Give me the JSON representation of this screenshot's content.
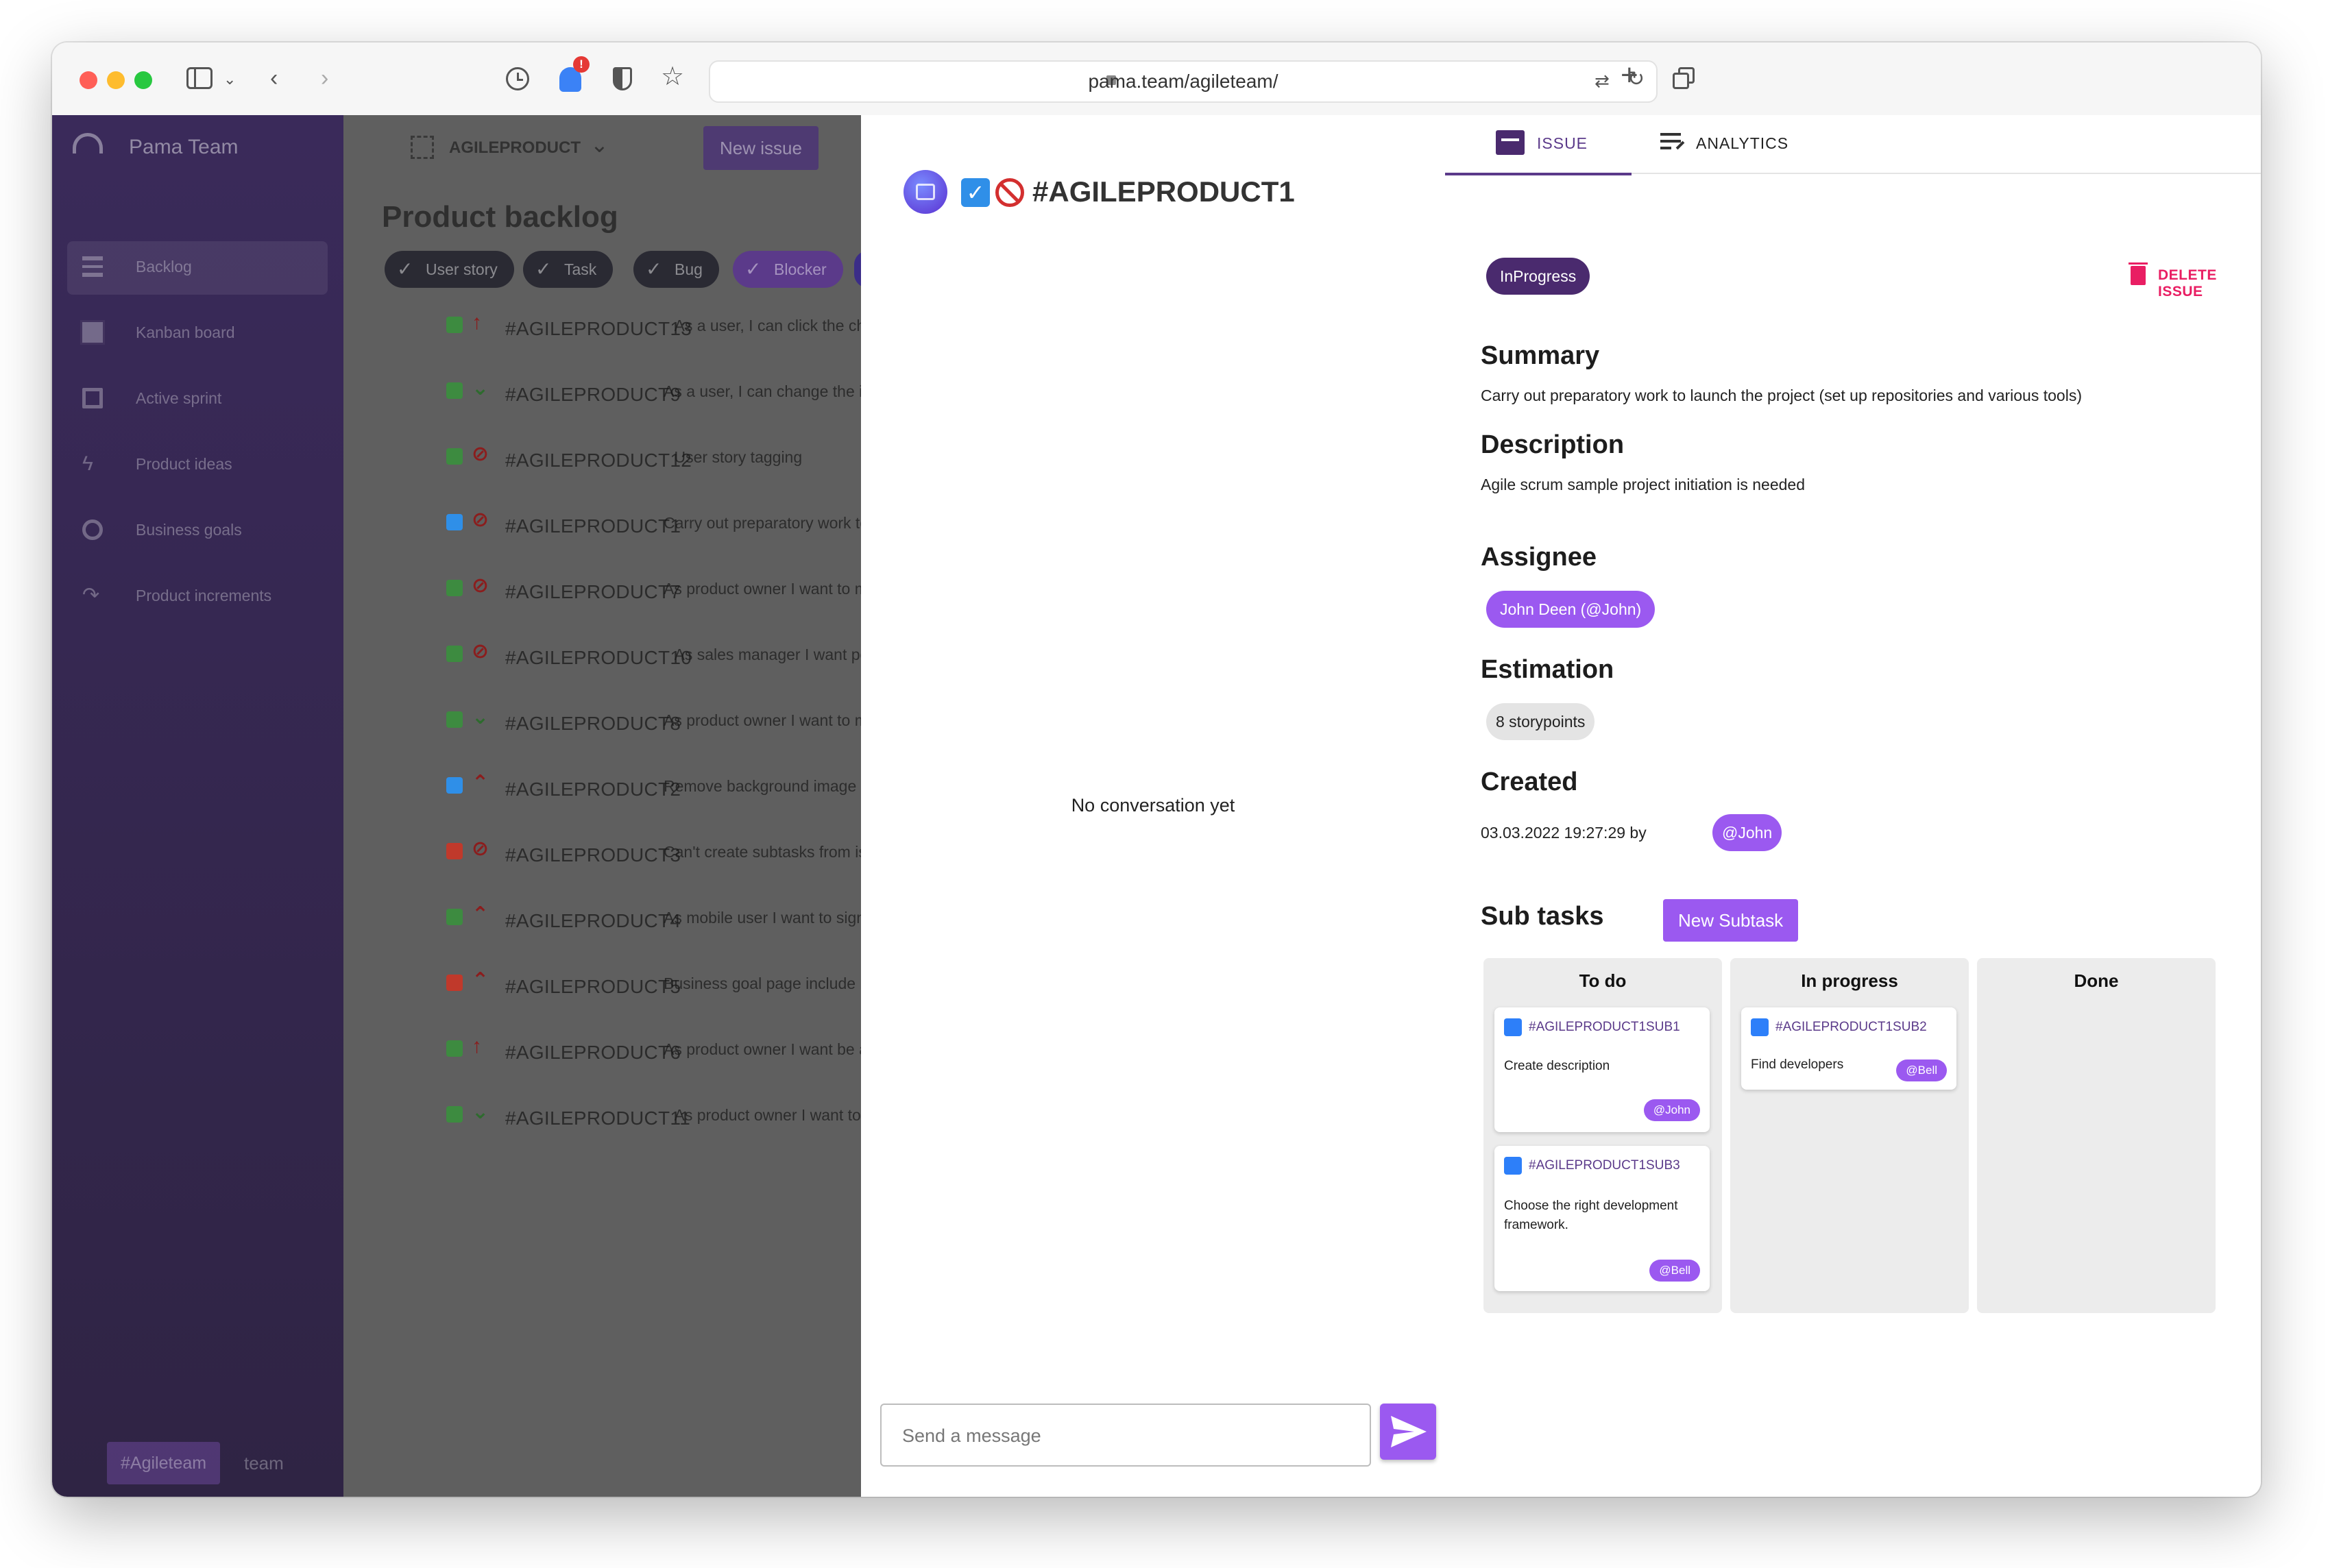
{
  "browser": {
    "url": "pama.team/agileteam/",
    "extension_badge": "!"
  },
  "app": {
    "brand": "Pama Team",
    "project_selector": "AGILEPRODUCT",
    "new_issue_label": "New issue",
    "page_title": "Product backlog",
    "sidebar_items": [
      {
        "label": "Backlog",
        "icon": "list-icon"
      },
      {
        "label": "Kanban board",
        "icon": "grid-icon"
      },
      {
        "label": "Active sprint",
        "icon": "sprint-icon"
      },
      {
        "label": "Product ideas",
        "icon": "bolt-icon"
      },
      {
        "label": "Business goals",
        "icon": "target-icon"
      },
      {
        "label": "Product increments",
        "icon": "redo-icon"
      }
    ],
    "team_tag": "#Agileteam",
    "team_label": "team",
    "filters": [
      "User story",
      "Task",
      "Bug",
      "Blocker"
    ],
    "backlog": [
      {
        "id": "#AGILEPRODUCT13",
        "text": "As a user, I can click the chat b",
        "type": "story",
        "priority": "arrow-up"
      },
      {
        "id": "#AGILEPRODUCT9",
        "text": "As a user, I can change the issue",
        "type": "story",
        "priority": "double-down"
      },
      {
        "id": "#AGILEPRODUCT12",
        "text": "User story tagging",
        "type": "story",
        "priority": "blocker"
      },
      {
        "id": "#AGILEPRODUCT1",
        "text": "Carry out preparatory work to lau",
        "type": "task",
        "priority": "blocker"
      },
      {
        "id": "#AGILEPRODUCT7",
        "text": "As product owner I want to mana",
        "type": "story",
        "priority": "blocker"
      },
      {
        "id": "#AGILEPRODUCT10",
        "text": "As sales manager I want potent",
        "type": "story",
        "priority": "blocker"
      },
      {
        "id": "#AGILEPRODUCT8",
        "text": "As product owner I want to mana",
        "type": "story",
        "priority": "double-down"
      },
      {
        "id": "#AGILEPRODUCT2",
        "text": "Remove background image grad",
        "type": "task",
        "priority": "double-up"
      },
      {
        "id": "#AGILEPRODUCT3",
        "text": "Can't create subtasks from issue",
        "type": "bug",
        "priority": "blocker"
      },
      {
        "id": "#AGILEPRODUCT4",
        "text": "As mobile user I want to sign in w",
        "type": "story",
        "priority": "double-up"
      },
      {
        "id": "#AGILEPRODUCT5",
        "text": "Business goal page include non-",
        "type": "bug",
        "priority": "double-up"
      },
      {
        "id": "#AGILEPRODUCT6",
        "text": "As product owner I want be able",
        "type": "story",
        "priority": "arrow-up"
      },
      {
        "id": "#AGILEPRODUCT11",
        "text": "As product owner I want to see",
        "type": "story",
        "priority": "double-down"
      }
    ]
  },
  "conversation": {
    "issue_key": "#AGILEPRODUCT1",
    "empty_text": "No conversation yet",
    "input_placeholder": "Send a message"
  },
  "issue": {
    "tabs": [
      "ISSUE",
      "ANALYTICS"
    ],
    "status": "InProgress",
    "delete_label": "DELETE ISSUE",
    "summary_heading": "Summary",
    "summary": "Carry out preparatory work to launch the project (set up repositories and various tools)",
    "description_heading": "Description",
    "description": "Agile scrum sample project initiation is needed",
    "assignee_heading": "Assignee",
    "assignee": "John Deen (@John)",
    "estimation_heading": "Estimation",
    "estimation": "8 storypoints",
    "created_heading": "Created",
    "created_at": "03.03.2022 19:27:29 by",
    "created_by": "@John",
    "subtasks_heading": "Sub tasks",
    "new_subtask_label": "New Subtask",
    "columns": [
      {
        "title": "To do",
        "cards": [
          {
            "id": "#AGILEPRODUCT1SUB1",
            "text": "Create description",
            "user": "@John"
          },
          {
            "id": "#AGILEPRODUCT1SUB3",
            "text": "Choose the right development framework.",
            "user": "@Bell"
          }
        ]
      },
      {
        "title": "In progress",
        "cards": [
          {
            "id": "#AGILEPRODUCT1SUB2",
            "text": "Find developers",
            "user": "@Bell"
          }
        ]
      },
      {
        "title": "Done",
        "cards": []
      }
    ]
  },
  "colors": {
    "accent": "#9b59f0",
    "status_pill": "#4a2a6e",
    "delete": "#e91e63",
    "tab_active": "#5b3a8a"
  }
}
